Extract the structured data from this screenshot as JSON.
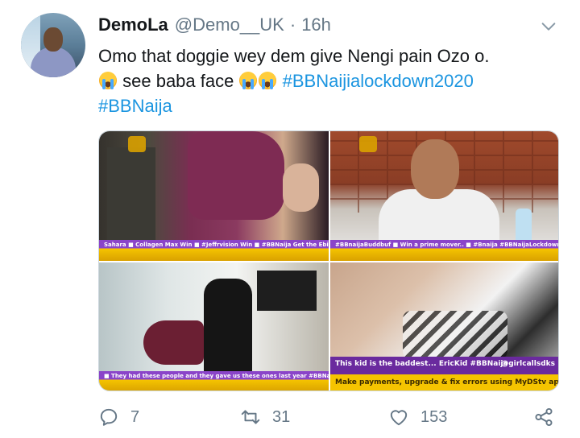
{
  "tweet": {
    "display_name": "DemoLa",
    "handle": "@Demo__UK",
    "separator": "·",
    "time": "16h",
    "text_line1": "Omo that doggie wey dem give Nengi pain Ozo o.",
    "text_line2_word": "see baba face",
    "hashtags": [
      "#BBNaijialockdown2020",
      "#BBNaija"
    ],
    "emoji": "loudly-crying-face"
  },
  "media": {
    "photos": [
      {
        "banner": "Sahara  ■ Collagen Max  Win ■ #Jeffrvision  Win ■ #BBNaija  Get the Ebi package in all your needs and never miss a moment of the action"
      },
      {
        "banner": "#BBnaijaBuddbuf  ■ Win a prime mover..  ■ #Bnaija #BBNaijaLockdown  ■ #Rsdnd_Ivalo_Win  get the best of everything  www.dstv.com  One App for everything! Make payme"
      },
      {
        "banner": "■ They had these people and they gave us these ones last year #BBNaija  ■ #bbnaija  ■ Win  ■ LIFE New movies & series. Connecting with the Premium Bouquet & get the best of everything"
      },
      {
        "banner_line1": "This kid is the baddest... EricKid #BBNaija",
        "banner_right": "@girlcallsdks",
        "banner_line2": "Make payments, upgrade & fix errors using MyDStv app"
      }
    ]
  },
  "actions": {
    "reply_count": "7",
    "retweet_count": "31",
    "like_count": "153"
  },
  "colors": {
    "text": "#14171a",
    "secondary": "#657786",
    "link": "#1b95e0"
  }
}
